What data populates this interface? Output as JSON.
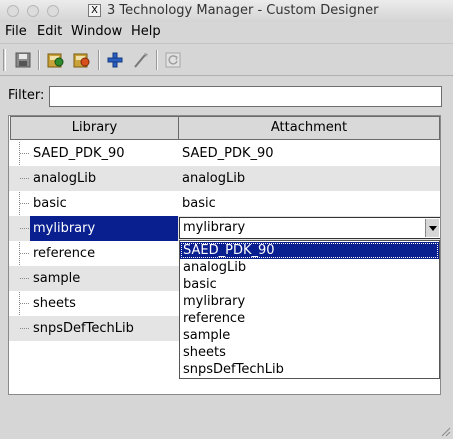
{
  "window": {
    "title": "3 Technology Manager - Custom Designer",
    "x_icon": "X"
  },
  "menu": [
    "File",
    "Edit",
    "Window",
    "Help"
  ],
  "toolbar": {
    "icons": [
      "save-icon",
      "export-icon",
      "import-icon",
      "add-icon",
      "edit-wand-icon",
      "refresh-icon"
    ]
  },
  "filter": {
    "label": "Filter:",
    "value": ""
  },
  "table": {
    "columns": [
      "Library",
      "Attachment"
    ],
    "rows": [
      {
        "library": "SAED_PDK_90",
        "attachment": "SAED_PDK_90"
      },
      {
        "library": "analogLib",
        "attachment": "analogLib"
      },
      {
        "library": "basic",
        "attachment": "basic"
      },
      {
        "library": "mylibrary",
        "attachment": "mylibrary"
      },
      {
        "library": "reference",
        "attachment": ""
      },
      {
        "library": "sample",
        "attachment": ""
      },
      {
        "library": "sheets",
        "attachment": ""
      },
      {
        "library": "snpsDefTechLib",
        "attachment": ""
      }
    ],
    "selected_library": "mylibrary"
  },
  "combo": {
    "value": "mylibrary",
    "options": [
      "SAED_PDK_90",
      "analogLib",
      "basic",
      "mylibrary",
      "reference",
      "sample",
      "sheets",
      "snpsDefTechLib"
    ],
    "highlighted": "SAED_PDK_90"
  },
  "colors": {
    "selection": "#0a1f8f",
    "alt_row": "#e4e4e4"
  }
}
